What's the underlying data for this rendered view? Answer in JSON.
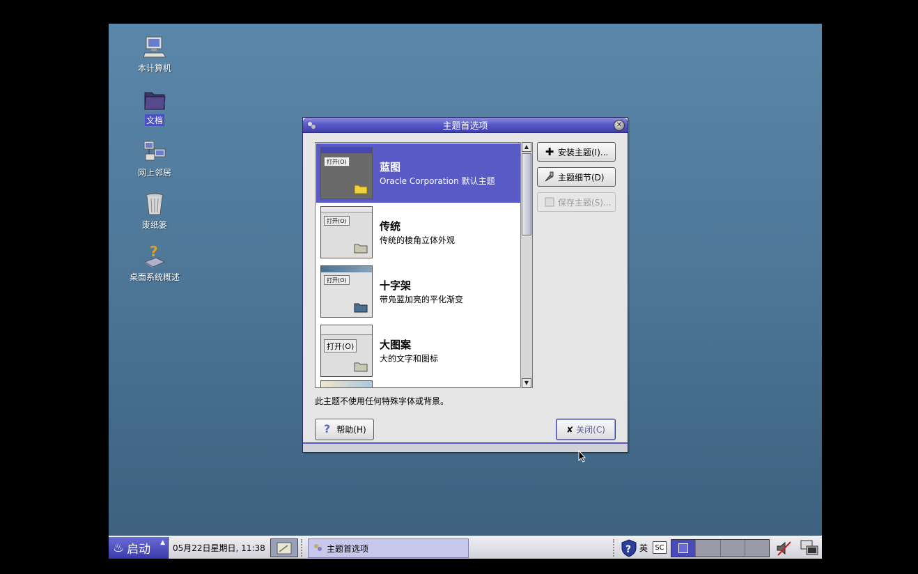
{
  "desktop": {
    "icons": [
      {
        "label": "本计算机",
        "icon": "computer-icon"
      },
      {
        "label": "文档",
        "icon": "documents-folder-icon"
      },
      {
        "label": "网上邻居",
        "icon": "network-icon"
      },
      {
        "label": "废纸篓",
        "icon": "trash-icon"
      },
      {
        "label": "桌面系统概述",
        "icon": "help-overview-icon"
      }
    ]
  },
  "dialog": {
    "title": "主题首选项",
    "themes": [
      {
        "name": "蓝图",
        "desc": "Oracle Corporation 默认主题",
        "open_label": "打开(O)"
      },
      {
        "name": "传统",
        "desc": "传统的棱角立体外观",
        "open_label": "打开(O)"
      },
      {
        "name": "十字架",
        "desc": "带凫蓝加亮的平化渐变",
        "open_label": "打开(O)"
      },
      {
        "name": "大图案",
        "desc": "大的文字和图标",
        "open_label": "打开(O)"
      }
    ],
    "buttons": {
      "install": "安装主题(I)...",
      "details": "主题细节(D)",
      "save": "保存主题(S)..."
    },
    "info_text": "此主题不使用任何特殊字体或背景。",
    "help_label": "帮助(H)",
    "close_label": "关闭(C)"
  },
  "taskbar": {
    "start_label": "启动",
    "clock": "05月22日星期日, 11:38",
    "task_item": "主题首选项",
    "lang_ying": "英",
    "lang_sc": "SC"
  },
  "colors": {
    "accent": "#5a5ac6",
    "desktop_top": "#5a87aa",
    "desktop_bottom": "#3c5f7d"
  }
}
